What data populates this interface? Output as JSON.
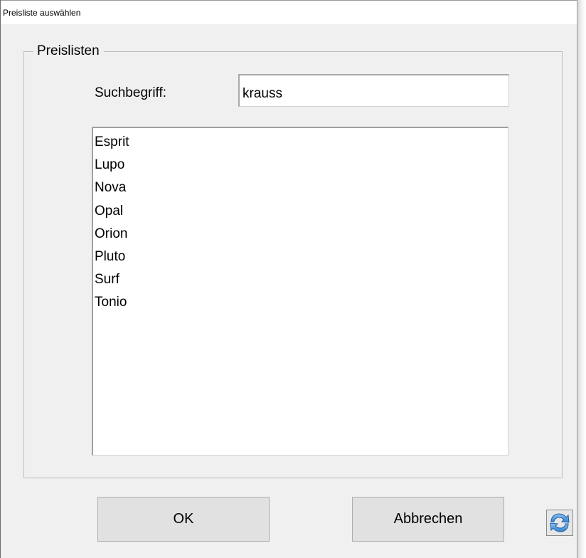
{
  "window": {
    "title": "Preisliste auswählen"
  },
  "group": {
    "legend": "Preislisten"
  },
  "search": {
    "label": "Suchbegriff:",
    "value": "krauss"
  },
  "list": {
    "items": [
      "Esprit",
      "Lupo",
      "Nova",
      "Opal",
      "Orion",
      "Pluto",
      "Surf",
      "Tonio"
    ]
  },
  "buttons": {
    "ok_label": "OK",
    "cancel_label": "Abbrechen",
    "refresh_icon": "refresh-icon"
  },
  "colors": {
    "window_background": "#f0f0f0",
    "button_face": "#e1e1e1",
    "refresh_icon_blue": "#2f7fd0"
  }
}
